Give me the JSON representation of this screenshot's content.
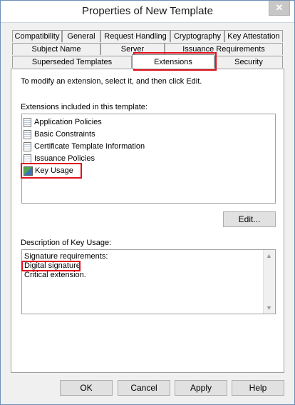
{
  "window": {
    "title": "Properties of New Template",
    "close_glyph": "✕"
  },
  "tabs": {
    "row1": [
      "Compatibility",
      "General",
      "Request Handling",
      "Cryptography",
      "Key Attestation"
    ],
    "row2": [
      "Subject Name",
      "Server",
      "Issuance Requirements"
    ],
    "row3": [
      "Superseded Templates",
      "Extensions",
      "Security"
    ],
    "active": "Extensions"
  },
  "extensions": {
    "instruction": "To modify an extension, select it, and then click Edit.",
    "list_label": "Extensions included in this template:",
    "items": [
      {
        "label": "Application Policies",
        "icon": "document-icon"
      },
      {
        "label": "Basic Constraints",
        "icon": "document-icon"
      },
      {
        "label": "Certificate Template Information",
        "icon": "document-icon"
      },
      {
        "label": "Issuance Policies",
        "icon": "document-icon"
      },
      {
        "label": "Key Usage",
        "icon": "key-usage-icon"
      }
    ],
    "selected": "Key Usage",
    "edit_button": "Edit...",
    "description_label": "Description of Key Usage:",
    "description_lines": [
      "Signature requirements:",
      "Digital signature",
      "Critical extension."
    ]
  },
  "footer": {
    "ok": "OK",
    "cancel": "Cancel",
    "apply": "Apply",
    "help": "Help"
  },
  "annotation_color": "#e0101c"
}
